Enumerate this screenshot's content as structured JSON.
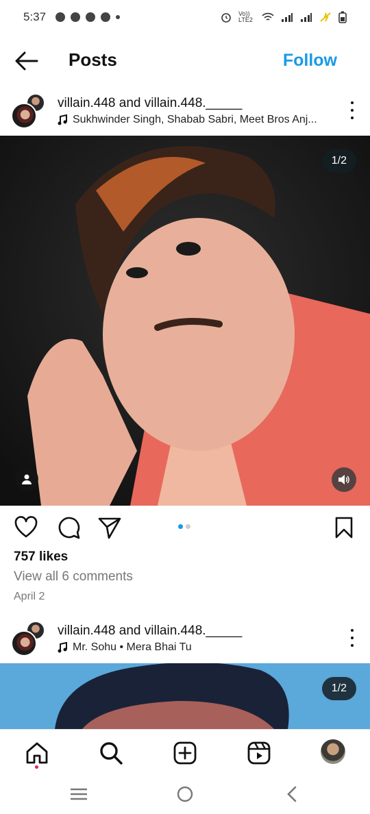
{
  "status_bar": {
    "time": "5:37",
    "network_label": "Vo)) LTE2",
    "icons": [
      "chat-icon",
      "snapchat-icon",
      "snapchat-icon",
      "snapchat-icon",
      "dot-icon",
      "alarm-icon",
      "wifi-icon",
      "signal-icon",
      "signal-icon",
      "charging-icon",
      "battery-icon"
    ]
  },
  "header": {
    "title": "Posts",
    "follow_label": "Follow",
    "back_icon": "arrow-left-icon"
  },
  "posts": [
    {
      "users_line": "villain.448 and villain.448._____",
      "music": "Sukhwinder Singh, Shabab Sabri, Meet Bros Anj...",
      "counter": "1/2",
      "likes": "757 likes",
      "comments": "View all 6 comments",
      "date": "April 2"
    },
    {
      "users_line": "villain.448 and villain.448._____",
      "music": "Mr. Sohu • Mera Bhai Tu",
      "counter": "1/2"
    }
  ],
  "bottom_nav": [
    "home-icon",
    "search-icon",
    "create-icon",
    "reels-icon",
    "profile-avatar"
  ],
  "colors": {
    "accent": "#1a9ae6",
    "text": "#111111",
    "muted": "#777777",
    "notification": "#e0245e"
  }
}
